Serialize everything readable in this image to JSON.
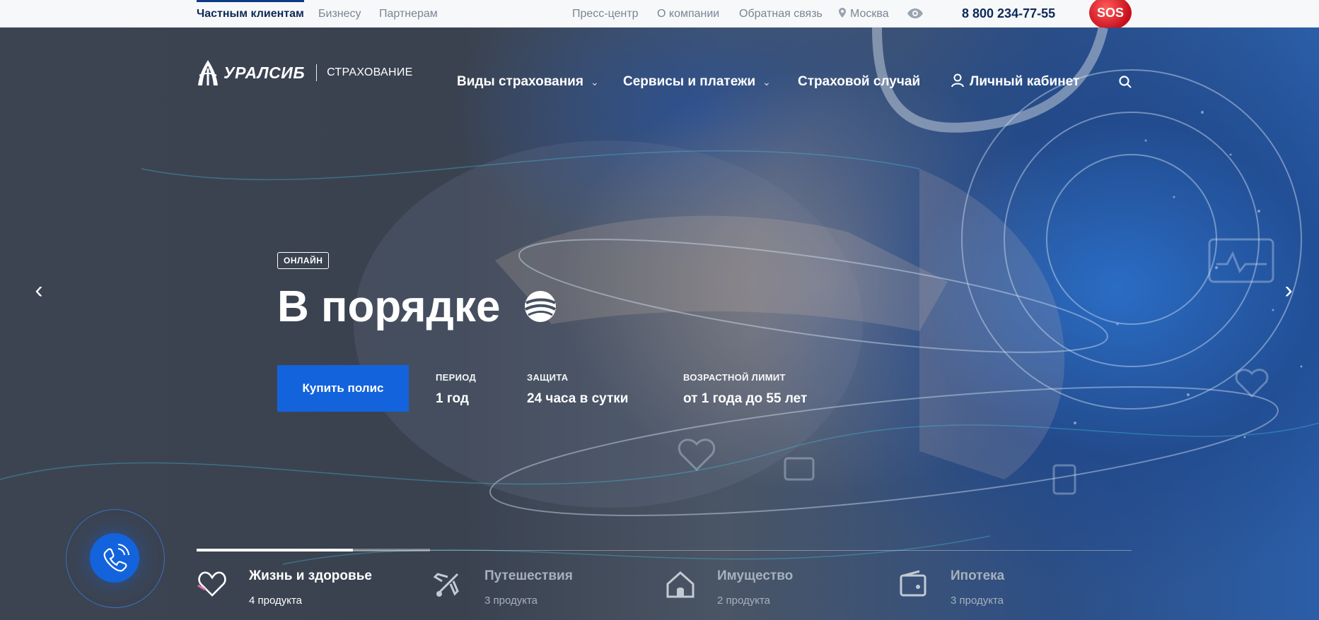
{
  "topbar": {
    "segments": [
      "Частным клиентам",
      "Бизнесу",
      "Партнерам"
    ],
    "links": [
      "Пресс-центр",
      "О компании",
      "Обратная связь"
    ],
    "city": "Москва",
    "phone": "8 800 234-77-55",
    "sos_label": "SOS"
  },
  "logo": {
    "name": "УРАЛСИБ",
    "sub": "СТРАХОВАНИЕ"
  },
  "nav": {
    "items": [
      "Виды страхования",
      "Сервисы и платежи",
      "Страховой случай",
      "Личный кабинет"
    ]
  },
  "hero": {
    "badge": "ОНЛАЙН",
    "title": "В порядке",
    "buy_label": "Купить полис",
    "stats": [
      {
        "label": "ПЕРИОД",
        "value": "1 год"
      },
      {
        "label": "ЗАЩИТА",
        "value": "24 часа в сутки"
      },
      {
        "label": "ВОЗРАСТНОЙ ЛИМИТ",
        "value": "от 1 года до 55 лет"
      }
    ],
    "slider_progress": 0.67
  },
  "categories": [
    {
      "name": "Жизнь и здоровье",
      "count": "4 продукта",
      "icon": "heart-icon"
    },
    {
      "name": "Путешествия",
      "count": "3 продукта",
      "icon": "plane-icon"
    },
    {
      "name": "Имущество",
      "count": "2 продукта",
      "icon": "house-icon"
    },
    {
      "name": "Ипотека",
      "count": "3 продукта",
      "icon": "wallet-icon"
    }
  ],
  "colors": {
    "brand_blue": "#1363dd",
    "sos_red": "#d4141f",
    "topbar_active": "#0d2a57"
  }
}
